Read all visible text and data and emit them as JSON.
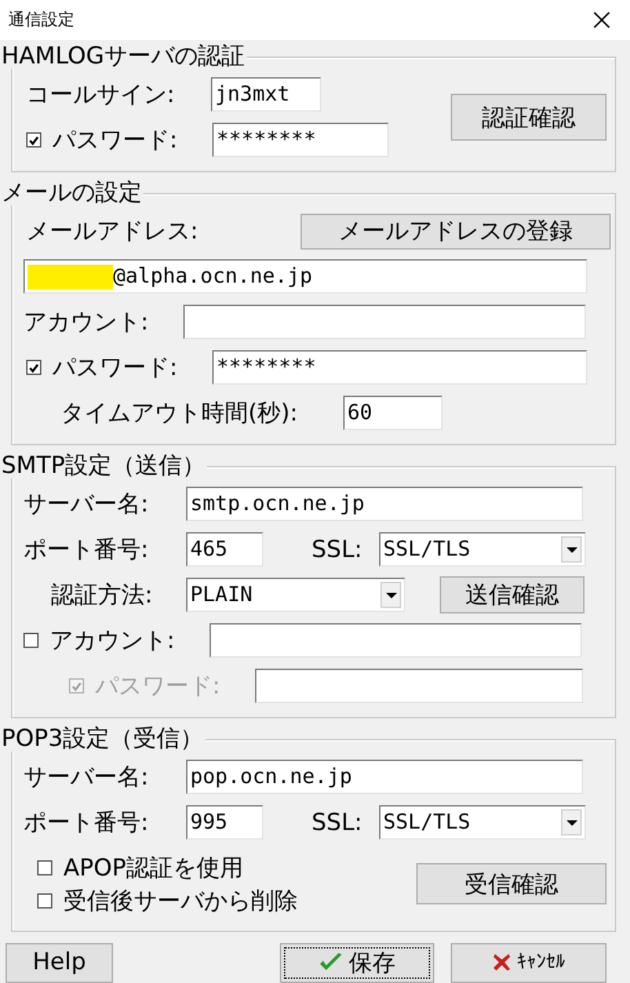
{
  "window": {
    "title": "通信設定"
  },
  "hamlog": {
    "title": "HAMLOGサーバの認証",
    "callsign": {
      "label": "コールサイン:",
      "value": "jn3mxt"
    },
    "password": {
      "label": "パスワード:",
      "value": "********",
      "checked": true
    },
    "button": "認証確認"
  },
  "mail": {
    "title": "メールの設定",
    "address_label": "メールアドレス:",
    "register_button": "メールアドレスの登録",
    "address": {
      "value": "@alpha.ocn.ne.jp",
      "redacted": true
    },
    "account": {
      "label": "アカウント:"
    },
    "password": {
      "label": "パスワード:",
      "value": "********",
      "checked": true
    },
    "timeout": {
      "label": "タイムアウト時間(秒):",
      "value": "60"
    }
  },
  "smtp": {
    "title": "SMTP設定（送信）",
    "server": {
      "label": "サーバー名:",
      "value": "smtp.ocn.ne.jp"
    },
    "port": {
      "label": "ポート番号:",
      "value": "465"
    },
    "ssl": {
      "label": "SSL:",
      "value": "SSL/TLS"
    },
    "auth": {
      "label": "認証方法:",
      "value": "PLAIN"
    },
    "button": "送信確認",
    "account": {
      "label": "アカウント:",
      "checked": false
    },
    "password": {
      "label": "パスワード:",
      "checked": true,
      "disabled": true
    }
  },
  "pop3": {
    "title": "POP3設定（受信）",
    "server": {
      "label": "サーバー名:",
      "value": "pop.ocn.ne.jp"
    },
    "port": {
      "label": "ポート番号:",
      "value": "995"
    },
    "ssl": {
      "label": "SSL:",
      "value": "SSL/TLS"
    },
    "options": [
      {
        "label": "APOP認証を使用",
        "checked": false
      },
      {
        "label": "受信後サーバから削除",
        "checked": false
      }
    ],
    "button": "受信確認"
  },
  "buttons": [
    {
      "label": "Help",
      "kind": "plain",
      "focused": false
    },
    {
      "label": "保存",
      "kind": "save",
      "focused": true
    },
    {
      "label": "ｷｬﾝｾﾙ",
      "kind": "cancel",
      "focused": false
    }
  ]
}
